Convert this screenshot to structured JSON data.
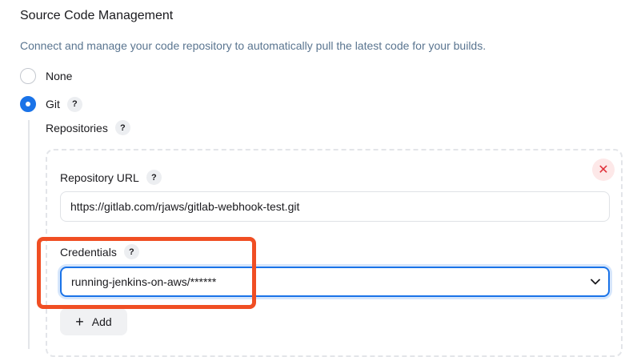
{
  "section": {
    "title": "Source Code Management",
    "description": "Connect and manage your code repository to automatically pull the latest code for your builds."
  },
  "scm_options": [
    {
      "label": "None",
      "selected": false
    },
    {
      "label": "Git",
      "selected": true
    }
  ],
  "help_glyph": "?",
  "repositories": {
    "label": "Repositories",
    "delete_glyph": "✕",
    "repository_url": {
      "label": "Repository URL",
      "value": "https://gitlab.com/rjaws/gitlab-webhook-test.git"
    },
    "credentials": {
      "label": "Credentials",
      "value": "running-jenkins-on-aws/******"
    },
    "add_button": {
      "icon": "plus-icon",
      "label": "Add"
    }
  },
  "colors": {
    "accent": "#1a73e8",
    "highlight": "#f04e23",
    "delete": "#e0303a"
  }
}
